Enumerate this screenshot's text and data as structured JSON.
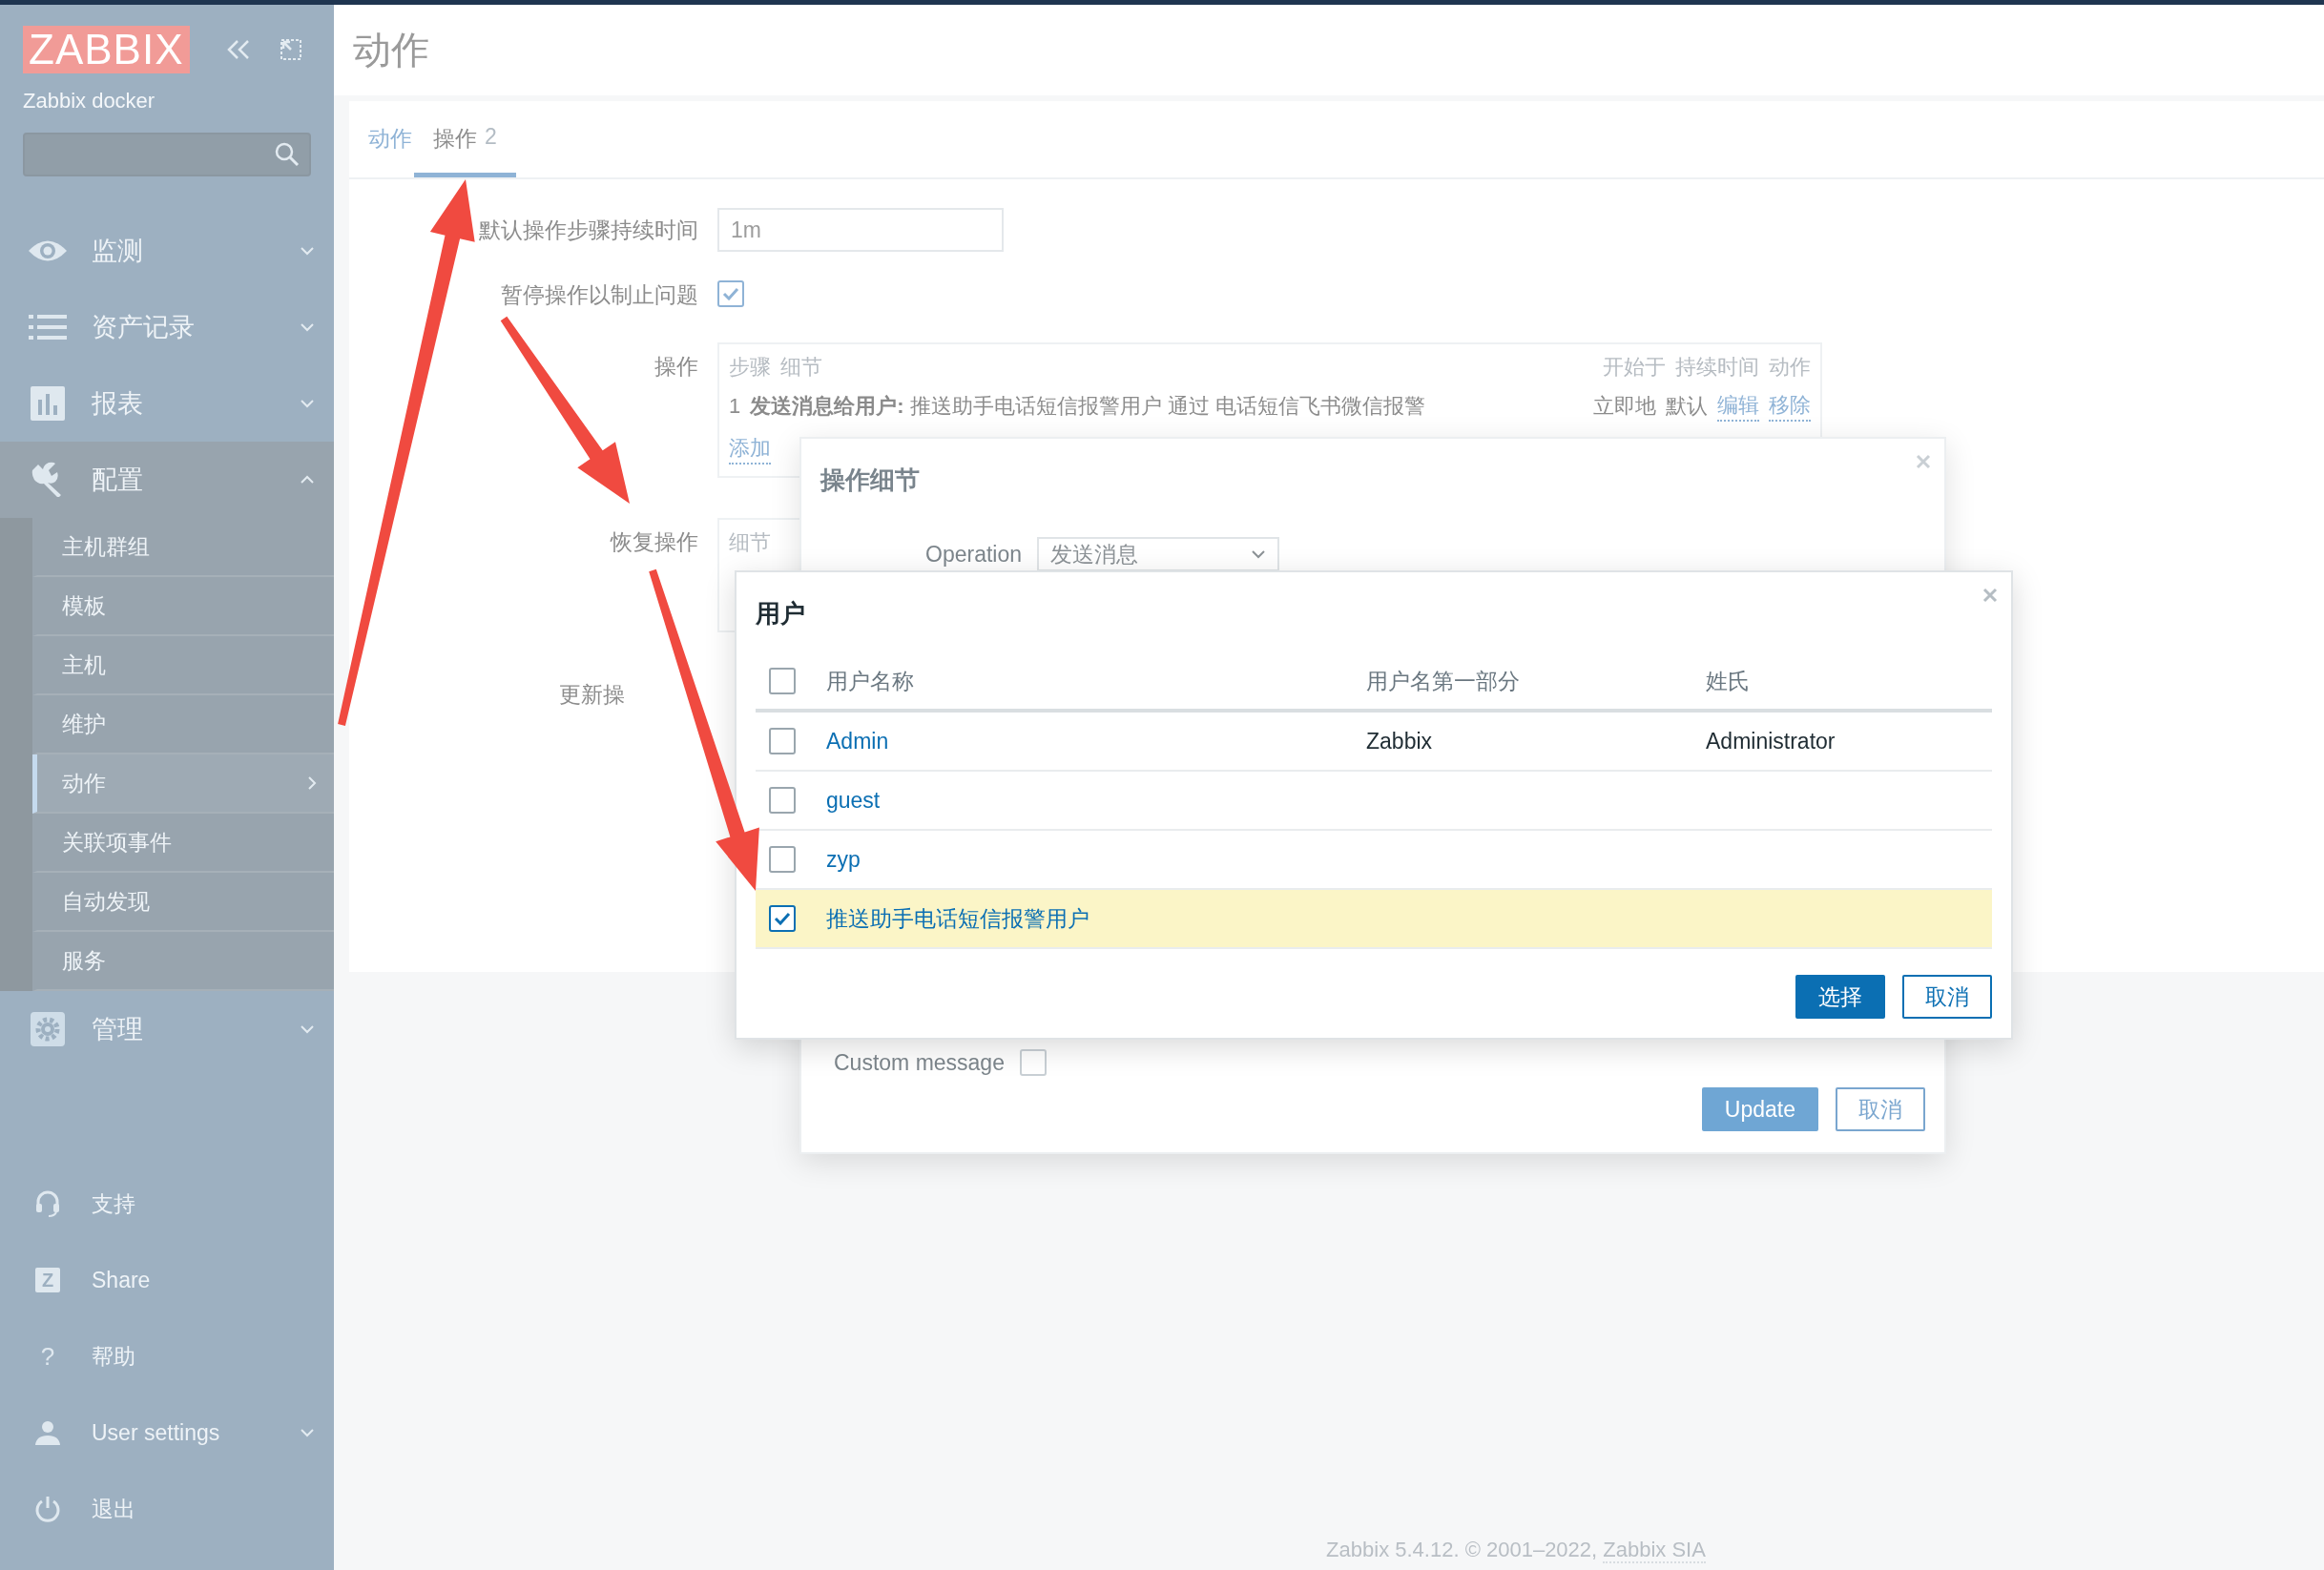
{
  "sidebar": {
    "logo": "ZABBIX",
    "server": "Zabbix docker",
    "menu": [
      {
        "label": "监测",
        "expanded": false
      },
      {
        "label": "资产记录",
        "expanded": false
      },
      {
        "label": "报表",
        "expanded": false
      },
      {
        "label": "配置",
        "expanded": true,
        "children": [
          {
            "label": "主机群组",
            "selected": false
          },
          {
            "label": "模板",
            "selected": false
          },
          {
            "label": "主机",
            "selected": false
          },
          {
            "label": "维护",
            "selected": false
          },
          {
            "label": "动作",
            "selected": true
          },
          {
            "label": "关联项事件",
            "selected": false
          },
          {
            "label": "自动发现",
            "selected": false
          },
          {
            "label": "服务",
            "selected": false
          }
        ]
      },
      {
        "label": "管理",
        "expanded": false
      }
    ],
    "user_menu": [
      {
        "label": "支持",
        "kind": "link"
      },
      {
        "label": "Share",
        "kind": "link",
        "icon_text": "Z"
      },
      {
        "label": "帮助",
        "kind": "link",
        "icon_text": "?"
      },
      {
        "label": "User settings",
        "kind": "submenu"
      },
      {
        "label": "退出",
        "kind": "link"
      }
    ]
  },
  "page": {
    "title": "动作",
    "tabs": [
      {
        "label": "动作",
        "selected": false
      },
      {
        "label": "操作",
        "count": "2",
        "selected": true
      }
    ],
    "form": {
      "duration": {
        "label": "默认操作步骤持续时间",
        "value": "1m"
      },
      "pause": {
        "label": "暂停操作以制止问题",
        "checked": true
      },
      "operations": {
        "label": "操作",
        "columns": [
          "步骤",
          "细节",
          "开始于",
          "持续时间",
          "动作"
        ],
        "rows": [
          {
            "step": "1",
            "details": "**发送消息给用户:** 推送助手电话短信报警用户 通过 电话短信飞书微信报警",
            "start": "立即地",
            "duration": "默认",
            "actions": [
              "编辑",
              "移除"
            ]
          }
        ],
        "add": "添加"
      },
      "recovery": {
        "label": "恢复操作",
        "columns": [
          "细节"
        ]
      },
      "update": {
        "label": "更新操"
      }
    },
    "footer": {
      "text": "Zabbix 5.4.12. © 2001–2022, ",
      "link": "Zabbix SIA"
    }
  },
  "operation_dialog": {
    "title": "操作细节",
    "operation": {
      "label": "Operation",
      "value": "发送消息"
    },
    "custom_message": {
      "label": "Custom message",
      "checked": false
    },
    "buttons": [
      {
        "label": "Update",
        "kind": "primary"
      },
      {
        "label": "取消",
        "kind": "secondary"
      }
    ]
  },
  "users_dialog": {
    "title": "用户",
    "all_checked": false,
    "columns": [
      "用户名称",
      "用户名第一部分",
      "姓氏"
    ],
    "rows": [
      {
        "username": "Admin",
        "name": "Zabbix",
        "surname": "Administrator",
        "checked": false
      },
      {
        "username": "guest",
        "checked": false
      },
      {
        "username": "zyp",
        "checked": false
      },
      {
        "username": "推送助手电话短信报警用户",
        "checked": true
      }
    ],
    "buttons": [
      {
        "label": "选择",
        "kind": "primary"
      },
      {
        "label": "取消",
        "kind": "secondary"
      }
    ]
  }
}
